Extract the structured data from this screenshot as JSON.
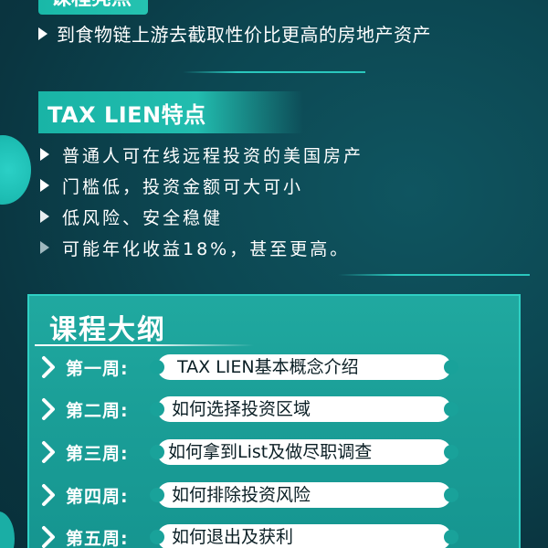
{
  "header": {
    "partial_title": "课程亮点",
    "tagline": "到食物链上游去截取性价比更高的房地产资产"
  },
  "tax_lien": {
    "title": "TAX LIEN特点",
    "features": [
      "普通人可在线远程投资的美国房产",
      "门槛低，投资金额可大可小",
      "低风险、安全稳健",
      "可能年化收益18%，甚至更高。"
    ]
  },
  "outline": {
    "title": "课程大纲",
    "weeks": [
      {
        "label": "第一周:",
        "topic": "TAX LIEN基本概念介绍"
      },
      {
        "label": "第二周:",
        "topic": "如何选择投资区域"
      },
      {
        "label": "第三周:",
        "topic": "如何拿到List及做尽职调查"
      },
      {
        "label": "第四周:",
        "topic": "如何排除投资风险"
      },
      {
        "label": "第五周:",
        "topic": "如何退出及获利"
      }
    ]
  },
  "colors": {
    "background": "#0b3a45",
    "accent": "#22bdaf",
    "panel": "#1a9e97",
    "pill": "#ffffff",
    "pill_text": "#0b1f25"
  },
  "icons": {
    "bullet": "triangle-right-icon",
    "week_marker": "chevron-right-icon"
  }
}
